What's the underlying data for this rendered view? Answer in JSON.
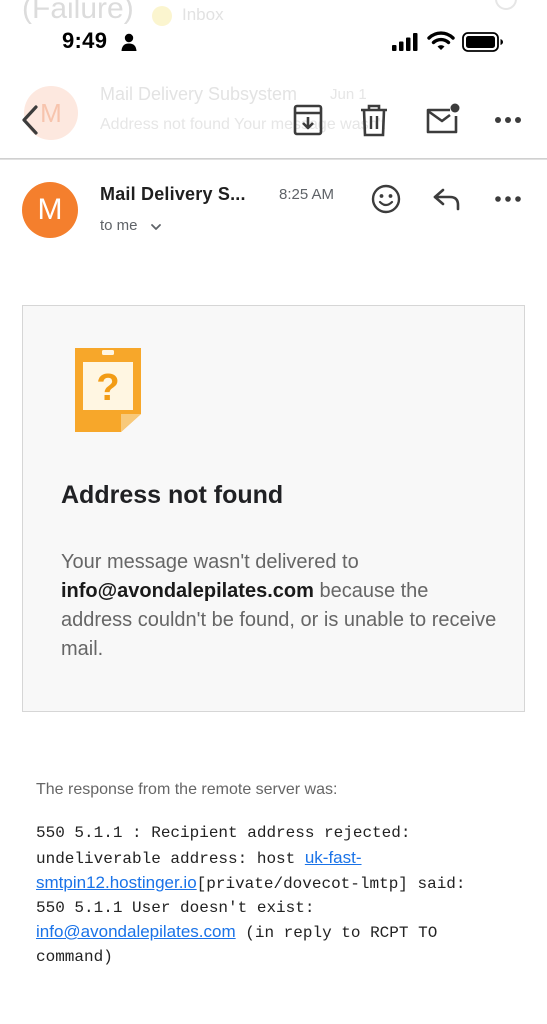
{
  "status_bar": {
    "time": "9:49"
  },
  "background": {
    "subject": "(Failure)",
    "label": "Inbox",
    "thread_avatar_initials": "M",
    "thread_sender": "Mail Delivery Subsystem",
    "thread_date": "Jun 1",
    "thread_snippet": "Address not found Your message wasn't"
  },
  "toolbar": {
    "icons": [
      "back-arrow",
      "archive",
      "trash",
      "mark-unread",
      "more-horizontal"
    ]
  },
  "message": {
    "avatar_initial": "M",
    "sender": "Mail Delivery S...",
    "time": "8:25 AM",
    "recipient": "to me",
    "actions": [
      "emoji-reaction",
      "reply",
      "more-horizontal"
    ]
  },
  "bounce_card": {
    "title": "Address not found",
    "body_before": "Your message wasn't delivered to ",
    "email": "info@avondalepilates.com",
    "body_after": " because the address couldn't be found, or is unable to receive mail."
  },
  "server_response": {
    "heading": "The response from the remote server was:",
    "line1": "550 5.1.1 : Recipient address rejected:",
    "line2_text": "undeliverable address: host ",
    "line2_link": "uk-fast-",
    "line3_link": "smtpin12.hostinger.io",
    "line3_text": "[private/dovecot-lmtp] said:",
    "line4": "550 5.1.1 User doesn't exist:",
    "line5_link": "info@avondalepilates.com",
    "line5_text": " (in reply to RCPT TO",
    "line6": "command)"
  },
  "colors": {
    "avatar": "#f47f2d",
    "link": "#1a73e8",
    "warning_icon": "#f5a623"
  }
}
